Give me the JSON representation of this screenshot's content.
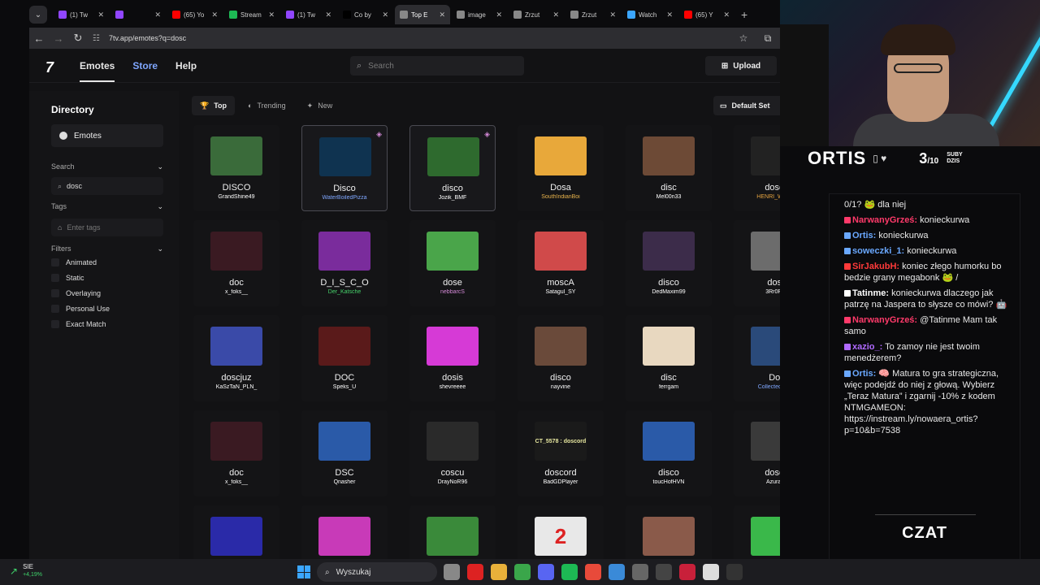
{
  "browser": {
    "tabs": [
      {
        "label": "(1) Tw",
        "color": "#9146ff"
      },
      {
        "label": "",
        "color": "#9146ff"
      },
      {
        "label": "(65) Yo",
        "color": "#ff0000"
      },
      {
        "label": "Stream",
        "color": "#1db954"
      },
      {
        "label": "(1) Tw",
        "color": "#9146ff"
      },
      {
        "label": "Co by",
        "color": "#000000"
      },
      {
        "label": "Top E",
        "color": "#888888",
        "active": true
      },
      {
        "label": "image",
        "color": "#888888"
      },
      {
        "label": "Zrzut",
        "color": "#888888"
      },
      {
        "label": "Zrzut",
        "color": "#888888"
      },
      {
        "label": "Watch",
        "color": "#3ba6ff"
      },
      {
        "label": "(65) Y",
        "color": "#ff0000"
      }
    ],
    "url": "7tv.app/emotes?q=dosc"
  },
  "site": {
    "nav": {
      "emotes": "Emotes",
      "store": "Store",
      "help": "Help"
    },
    "search_placeholder": "Search",
    "upload_label": "Upload",
    "sidebar": {
      "directory": "Directory",
      "emotes_item": "Emotes",
      "search_heading": "Search",
      "search_value": "dosc",
      "tags_heading": "Tags",
      "tags_placeholder": "Enter tags",
      "filters_heading": "Filters",
      "filters": [
        "Animated",
        "Static",
        "Overlaying",
        "Personal Use",
        "Exact Match"
      ]
    },
    "sort": {
      "top": "Top",
      "trending": "Trending",
      "new": "New"
    },
    "default_set": "Default Set",
    "emotes": [
      {
        "name": "DISCO",
        "owner": "GrandShine49",
        "owner_color": "#ffffff",
        "thumb": "#3a6b3a"
      },
      {
        "name": "Disco",
        "owner": "WaterBoiledPizza",
        "owner_color": "#7fa7ff",
        "thumb": "#0f3350",
        "selected": true
      },
      {
        "name": "disco",
        "owner": "Jozik_BMF",
        "owner_color": "#ffffff",
        "thumb": "#2e6a2e",
        "selected": true
      },
      {
        "name": "Dosa",
        "owner": "SouthIndianBoi",
        "owner_color": "#e7b24b",
        "thumb": "#e8a83a"
      },
      {
        "name": "disc",
        "owner": "Mel00n33",
        "owner_color": "#ffffff",
        "thumb": "#6d4a36"
      },
      {
        "name": "dosco",
        "owner": "HENRI_WITH_I",
        "owner_color": "#e7a540",
        "thumb": "#222222"
      },
      {
        "name": "doc",
        "owner": "x_foks__",
        "owner_color": "#ffffff",
        "thumb": "#3a1a22"
      },
      {
        "name": "D_I_S_C_O",
        "owner": "Der_Katsche",
        "owner_color": "#46d36b",
        "thumb": "#7a2c9c"
      },
      {
        "name": "dose",
        "owner": "nebbarcS",
        "owner_color": "#d58ad8",
        "thumb": "#4aa54a"
      },
      {
        "name": "moscA",
        "owner": "Satagul_SY",
        "owner_color": "#ffffff",
        "thumb": "#d04a4a"
      },
      {
        "name": "disco",
        "owner": "DedMaxim99",
        "owner_color": "#ffffff",
        "thumb": "#3c2c4a"
      },
      {
        "name": "dosc",
        "owner": "3Rr0Rek",
        "owner_color": "#ffffff",
        "thumb": "#6c6c6c"
      },
      {
        "name": "doscjuz",
        "owner": "KaSzTaN_PLN_",
        "owner_color": "#ffffff",
        "thumb": "#3a4aa8"
      },
      {
        "name": "DOC",
        "owner": "Speks_U",
        "owner_color": "#ffffff",
        "thumb": "#5a1a1a"
      },
      {
        "name": "dosis",
        "owner": "shevreeee",
        "owner_color": "#ffffff",
        "thumb": "#d63ad6"
      },
      {
        "name": "disco",
        "owner": "nayvine",
        "owner_color": "#ffffff",
        "thumb": "#6a4a3a"
      },
      {
        "name": "disc",
        "owner": "ferrgam",
        "owner_color": "#ffffff",
        "thumb": "#e8d8c0"
      },
      {
        "name": "Doc",
        "owner": "CollectedVibes",
        "owner_color": "#7fa7ff",
        "thumb": "#2a4a7a"
      },
      {
        "name": "doc",
        "owner": "x_foks__",
        "owner_color": "#ffffff",
        "thumb": "#3a1a22"
      },
      {
        "name": "DSC",
        "owner": "Qnasher",
        "owner_color": "#ffffff",
        "thumb": "#2a5aa8"
      },
      {
        "name": "coscu",
        "owner": "DrayNoR96",
        "owner_color": "#ffffff",
        "thumb": "#2a2a2a"
      },
      {
        "name": "doscord",
        "owner": "BadGDPlayer",
        "owner_color": "#ffffff",
        "thumb": "#1a1a1a",
        "thumb_text": "CT_5578 : doscord"
      },
      {
        "name": "disco",
        "owner": "toucHofHVN",
        "owner_color": "#ffffff",
        "thumb": "#2a5aa8"
      },
      {
        "name": "dosco",
        "owner": "Azurah_",
        "owner_color": "#ffffff",
        "thumb": "#3a3a3a"
      },
      {
        "name": "",
        "owner": "",
        "owner_color": "#ffffff",
        "thumb": "#2a2aa8"
      },
      {
        "name": "",
        "owner": "",
        "owner_color": "#ffffff",
        "thumb": "#c83ab8"
      },
      {
        "name": "",
        "owner": "",
        "owner_color": "#ffffff",
        "thumb": "#3a8a3a"
      },
      {
        "name": "",
        "owner": "",
        "owner_color": "#ffffff",
        "thumb": "#e8e8e8",
        "thumb_text": "2"
      },
      {
        "name": "",
        "owner": "",
        "owner_color": "#ffffff",
        "thumb": "#8a5a4a"
      },
      {
        "name": "",
        "owner": "",
        "owner_color": "#ffffff",
        "thumb": "#3ab84a"
      }
    ]
  },
  "stream": {
    "nick": "ORTIS",
    "subs": "3",
    "subs_goal": "/10",
    "subs_label_1": "SUBY",
    "subs_label_2": "DZIS",
    "chat_title": "CZAT",
    "chat": [
      {
        "user": "",
        "text": "0/1? 🐸 dla niej",
        "color": "#ffffff"
      },
      {
        "user": "NarwanyGrześ:",
        "text": "konieckurwa",
        "color": "#ff3a6a"
      },
      {
        "user": "Ortis:",
        "text": "konieckurwa",
        "color": "#6aa8ff"
      },
      {
        "user": "soweczki_1:",
        "text": "konieckurwa",
        "color": "#6aa8ff"
      },
      {
        "user": "SirJakubH:",
        "text": "koniec złego humorku bo bedzie grany megabonk 🐸 /",
        "color": "#ff3a3a"
      },
      {
        "user": "Tatinme:",
        "text": "konieckurwa dlaczego jak patrzę na Jaspera to słysze co mówi? 🤖",
        "color": "#ffffff"
      },
      {
        "user": "NarwanyGrześ:",
        "text": "@Tatinme Mam tak samo",
        "color": "#ff3a6a"
      },
      {
        "user": "xazio_:",
        "text": "To zamoy nie jest twoim menedżerem?",
        "color": "#b06aff"
      },
      {
        "user": "Ortis:",
        "text": "🧠 Matura to gra strategiczna, więc podejdź do niej z głową. Wybierz „Teraz Matura” i zgarnij -10% z kodem NTMGAMEON: https://instream.ly/nowaera_ortis?p=10&b=7538",
        "color": "#6aa8ff"
      }
    ]
  },
  "taskbar": {
    "weather_line1": "SIE",
    "weather_line2": "+4,19%",
    "search_placeholder": "Wyszukaj"
  }
}
